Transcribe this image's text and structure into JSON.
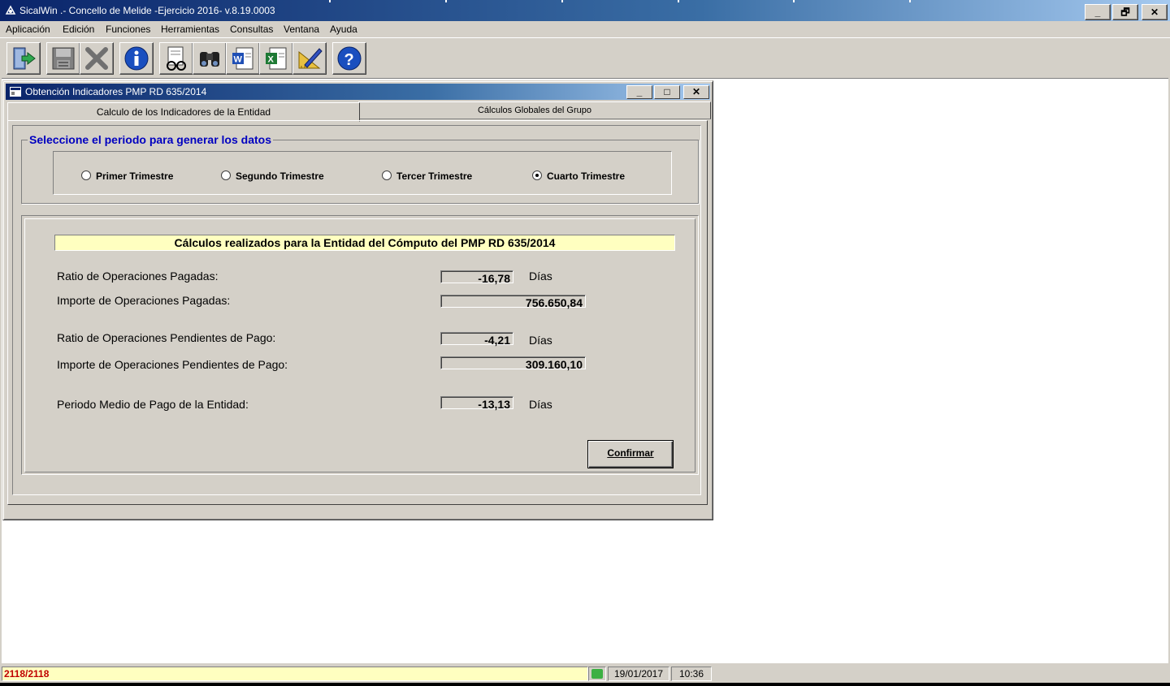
{
  "app": {
    "title": "SicalWin  .- Concello de Melide -Ejercicio 2016- v.8.19.0003",
    "caption_buttons": {
      "minimize": "_",
      "restore": "🗗",
      "close": "✕"
    }
  },
  "menu": {
    "items": [
      "Aplicación",
      "Edición",
      "Funciones",
      "Herramientas",
      "Consultas",
      "Ventana",
      "Ayuda"
    ]
  },
  "toolbar": {
    "buttons": [
      {
        "icon": "exit-door-icon"
      },
      {
        "icon": "save-disk-icon"
      },
      {
        "icon": "delete-x-icon"
      },
      {
        "icon": "info-icon"
      },
      {
        "icon": "preview-glasses-icon"
      },
      {
        "icon": "binoculars-icon"
      },
      {
        "icon": "word-icon"
      },
      {
        "icon": "excel-icon"
      },
      {
        "icon": "ruler-edit-icon"
      },
      {
        "icon": "help-icon"
      }
    ]
  },
  "child_window": {
    "title": "Obtención Indicadores PMP RD 635/2014",
    "caption_buttons": {
      "minimize": "_",
      "maximize": "□",
      "close": "✕"
    },
    "tabs": [
      {
        "label": "Calculo de los Indicadores de la Entidad",
        "active": true
      },
      {
        "label": "Cálculos Globales del Grupo",
        "active": false
      }
    ]
  },
  "period": {
    "legend": "Seleccione el periodo para generar los datos",
    "options": [
      {
        "label": "Primer Trimestre",
        "selected": false
      },
      {
        "label": "Segundo Trimestre",
        "selected": false
      },
      {
        "label": "Tercer Trimestre",
        "selected": false
      },
      {
        "label": "Cuarto Trimestre",
        "selected": true
      }
    ]
  },
  "results": {
    "title": "Cálculos realizados para la Entidad del Cómputo del PMP RD 635/2014",
    "ratio_pagadas": {
      "label": "Ratio de Operaciones Pagadas:",
      "value": "-16,78",
      "unit": "Días"
    },
    "importe_pagadas": {
      "label": "Importe de Operaciones Pagadas:",
      "value": "756.650,84"
    },
    "ratio_pendientes": {
      "label": "Ratio de Operaciones Pendientes de Pago:",
      "value": "-4,21",
      "unit": "Días"
    },
    "importe_pendientes": {
      "label": "Importe de Operaciones Pendientes de Pago:",
      "value": "309.160,10"
    },
    "pmp": {
      "label": "Periodo Medio de Pago de la Entidad:",
      "value": "-13,13",
      "unit": "Días"
    },
    "confirm_label": "Confirmar"
  },
  "statusbar": {
    "counter": "2118/2118",
    "date": "19/01/2017",
    "time": "10:36"
  },
  "colors": {
    "title_gradient_start": "#0a246a",
    "legend_blue": "#0000c0",
    "highlight_yellow": "#ffffc0",
    "counter_red": "#c00000",
    "status_green": "#3cb043"
  }
}
